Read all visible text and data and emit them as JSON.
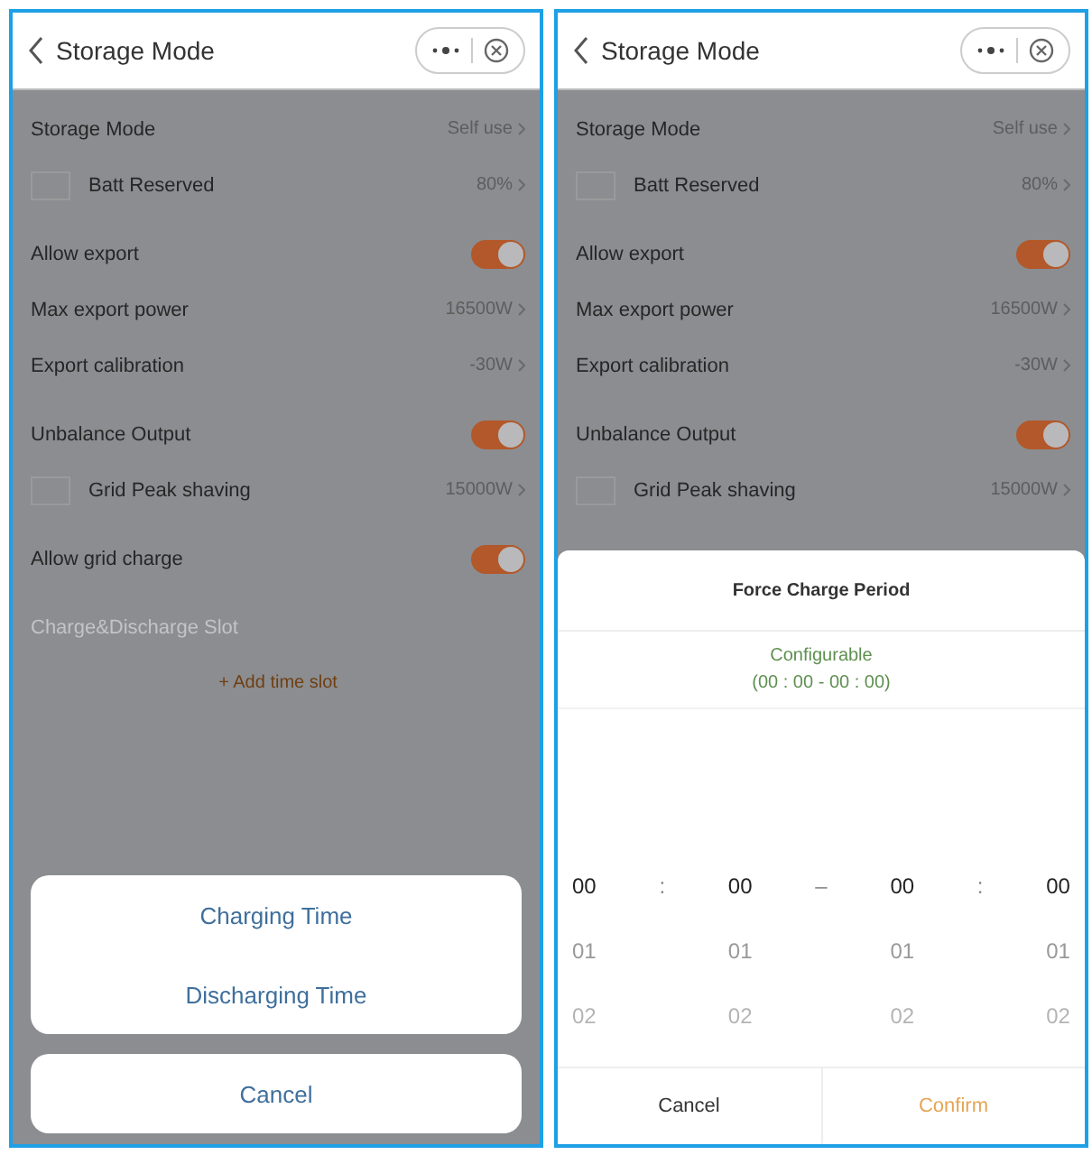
{
  "screens": [
    {
      "title": "Storage Mode",
      "groups": [
        [
          {
            "kind": "value",
            "label": "Storage Mode",
            "value": "Self use"
          },
          {
            "kind": "check",
            "label": "Batt Reserved",
            "value": "80%",
            "checked": false
          }
        ],
        [
          {
            "kind": "toggle",
            "label": "Allow export",
            "on": true
          },
          {
            "kind": "value",
            "label": "Max export power",
            "value": "16500W"
          },
          {
            "kind": "value",
            "label": "Export calibration",
            "value": "-30W"
          }
        ],
        [
          {
            "kind": "toggle",
            "label": "Unbalance Output",
            "on": true
          },
          {
            "kind": "check",
            "label": "Grid Peak shaving",
            "value": "15000W",
            "checked": false
          }
        ],
        [
          {
            "kind": "toggle",
            "label": "Allow grid charge",
            "on": true
          }
        ],
        [
          {
            "kind": "section",
            "label": "Charge&Discharge Slot"
          },
          {
            "kind": "link",
            "label": "+ Add time slot"
          }
        ]
      ],
      "sheet": {
        "kind": "actions",
        "options": [
          "Charging Time",
          "Discharging Time"
        ],
        "cancel": "Cancel"
      }
    },
    {
      "title": "Storage Mode",
      "groups": [
        [
          {
            "kind": "value",
            "label": "Storage Mode",
            "value": "Self use"
          },
          {
            "kind": "check",
            "label": "Batt Reserved",
            "value": "80%",
            "checked": false
          }
        ],
        [
          {
            "kind": "toggle",
            "label": "Allow export",
            "on": true
          },
          {
            "kind": "value",
            "label": "Max export power",
            "value": "16500W"
          },
          {
            "kind": "value",
            "label": "Export calibration",
            "value": "-30W"
          }
        ],
        [
          {
            "kind": "toggle",
            "label": "Unbalance Output",
            "on": true
          },
          {
            "kind": "check",
            "label": "Grid Peak shaving",
            "value": "15000W",
            "checked": false
          }
        ]
      ],
      "sheet": {
        "kind": "picker",
        "title": "Force Charge Period",
        "subtitle": "Configurable",
        "range": "(00 : 00 - 00 : 00)",
        "columns": [
          {
            "values": [
              "00",
              "01",
              "02"
            ]
          },
          {
            "sep": ":"
          },
          {
            "values": [
              "00",
              "01",
              "02"
            ]
          },
          {
            "sep": "–"
          },
          {
            "values": [
              "00",
              "01",
              "02"
            ]
          },
          {
            "sep": ":"
          },
          {
            "values": [
              "00",
              "01",
              "02"
            ]
          }
        ],
        "cancel": "Cancel",
        "confirm": "Confirm"
      }
    }
  ]
}
